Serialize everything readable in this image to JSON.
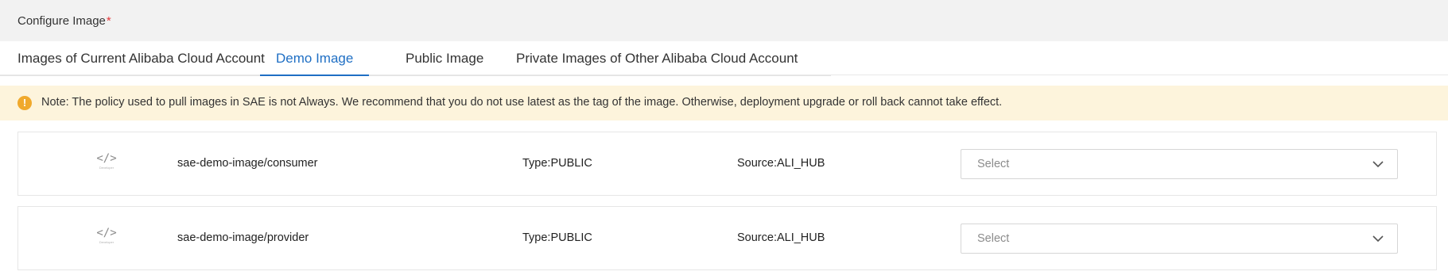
{
  "header": {
    "title": "Configure Image",
    "required_mark": "*"
  },
  "tabs": [
    {
      "label": "Images of Current Alibaba Cloud Account",
      "active": false
    },
    {
      "label": "Demo Image",
      "active": true
    },
    {
      "label": "Public Image",
      "active": false
    },
    {
      "label": "Private Images of Other Alibaba Cloud Account",
      "active": false
    }
  ],
  "notice": {
    "icon": "warning-icon",
    "icon_glyph": "!",
    "text": "Note: The policy used to pull images in SAE is not Always. We recommend that you do not use latest as the tag of the image. Otherwise, deployment upgrade or roll back cannot take effect."
  },
  "images": [
    {
      "icon": "code-icon",
      "icon_glyph": "</>",
      "icon_caption": "Developer",
      "name": "sae-demo-image/consumer",
      "type": "Type:PUBLIC",
      "source": "Source:ALI_HUB",
      "select_placeholder": "Select"
    },
    {
      "icon": "code-icon",
      "icon_glyph": "</>",
      "icon_caption": "Developer",
      "name": "sae-demo-image/provider",
      "type": "Type:PUBLIC",
      "source": "Source:ALI_HUB",
      "select_placeholder": "Select"
    }
  ],
  "colors": {
    "accent": "#1f6fc4",
    "notice_bg": "#fdf4dc",
    "warning": "#f0a92c",
    "header_bg": "#f2f2f2",
    "required": "#e4393c"
  }
}
